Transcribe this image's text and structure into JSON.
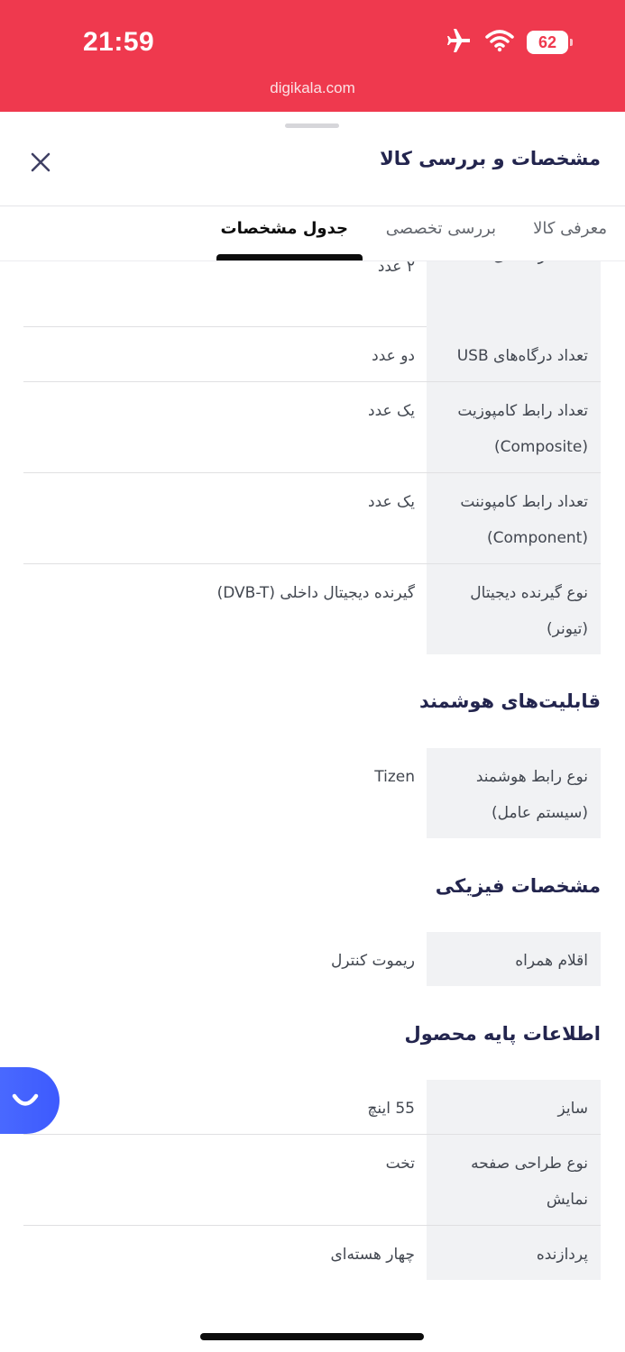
{
  "status_bar": {
    "time": "21:59",
    "battery": "62",
    "url": "digikala.com",
    "background_color": "#ef394e"
  },
  "header": {
    "title": "مشخصات و بررسی کالا",
    "close_icon": "close-icon"
  },
  "tabs": [
    {
      "label": "معرفی کالا",
      "active": false
    },
    {
      "label": "بررسی تخصصی",
      "active": false
    },
    {
      "label": "جدول مشخصات",
      "active": true
    }
  ],
  "connections": [
    {
      "key": "تعداد درگاه‌های HDMI",
      "value": "۲ عدد"
    },
    {
      "key": "تعداد درگاه‌های USB",
      "value": "دو عدد"
    },
    {
      "key": "تعداد رابط کامپوزیت (Composite)",
      "value": "یک عدد"
    },
    {
      "key": "تعداد رابط کامپوننت (Component)",
      "value": "یک عدد"
    },
    {
      "key": "نوع گیرنده دیجیتال (تیونر)",
      "value": "گیرنده دیجیتال داخلی (DVB-T)"
    }
  ],
  "smart": {
    "title": "قابلیت‌های هوشمند",
    "rows": [
      {
        "key": "نوع رابط هوشمند (سیستم عامل)",
        "value": "Tizen"
      }
    ]
  },
  "physical": {
    "title": "مشخصات فیزیکی",
    "rows": [
      {
        "key": "اقلام همراه",
        "value": "ریموت کنترل"
      }
    ]
  },
  "basic": {
    "title": "اطلاعات پایه محصول",
    "rows": [
      {
        "key": "سایز",
        "value": "55 اینچ"
      },
      {
        "key": "نوع طراحی صفحه نمایش",
        "value": "تخت"
      },
      {
        "key": "پردازنده",
        "value": "چهار هسته‌ای"
      }
    ]
  },
  "chat_button": {
    "icon": "smile-chat-icon",
    "color": "#3d5afe"
  }
}
